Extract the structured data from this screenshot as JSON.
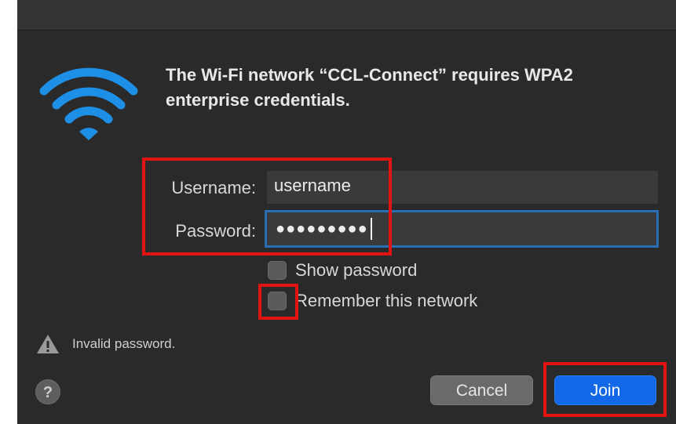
{
  "dialog": {
    "title": "The Wi-Fi network “CCL-Connect” requires WPA2\nenterprise credentials."
  },
  "form": {
    "username_label": "Username:",
    "username_value": "username",
    "password_label": "Password:",
    "password_masked": "●●●●●●●●●"
  },
  "options": {
    "show_password_label": "Show password",
    "show_password_checked": false,
    "remember_network_label": "Remember this network",
    "remember_network_checked": false
  },
  "status": {
    "message": "Invalid password.",
    "icon": "warning-icon"
  },
  "buttons": {
    "help_label": "?",
    "cancel_label": "Cancel",
    "join_label": "Join"
  },
  "colors": {
    "wifi_icon": "#1e8fe6",
    "join_button": "#1268e6",
    "focus_ring": "#2a6fb4",
    "annotation_box": "#e11414"
  },
  "annotations": {
    "highlighted": [
      "credentials-fields",
      "remember-network-checkbox",
      "join-button"
    ]
  }
}
